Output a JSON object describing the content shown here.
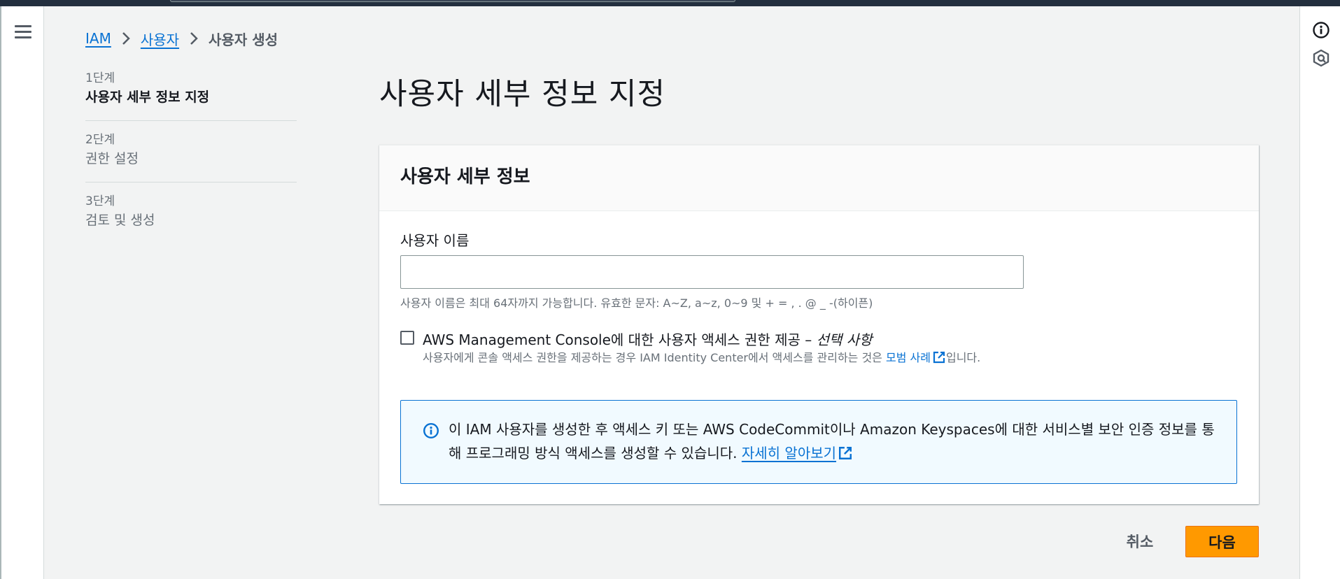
{
  "breadcrumb": {
    "items": [
      "IAM",
      "사용자"
    ],
    "current": "사용자 생성"
  },
  "steps": [
    {
      "number": "1단계",
      "title": "사용자 세부 정보 지정",
      "active": true
    },
    {
      "number": "2단계",
      "title": "권한 설정",
      "active": false
    },
    {
      "number": "3단계",
      "title": "검토 및 생성",
      "active": false
    }
  ],
  "page": {
    "title": "사용자 세부 정보 지정"
  },
  "container": {
    "title": "사용자 세부 정보",
    "username_label": "사용자 이름",
    "username_value": "",
    "username_help": "사용자 이름은 최대 64자까지 가능합니다. 유효한 문자: A~Z, a~z, 0~9 및 + = , . @ _ -(하이픈)",
    "console_access_label": "AWS Management Console에 대한 사용자 액세스 권한 제공 – ",
    "console_access_optional": "선택 사항",
    "console_access_checked": false,
    "console_access_desc_prefix": "사용자에게 콘솔 액세스 권한을 제공하는 경우 IAM Identity Center에서 액세스를 관리하는 것은 ",
    "console_access_desc_link": "모범 사례",
    "console_access_desc_suffix": "입니다."
  },
  "alert": {
    "text": "이 IAM 사용자를 생성한 후 액세스 키 또는 AWS CodeCommit이나 Amazon Keyspaces에 대한 서비스별 보안 인증 정보를 통해 프로그래밍 방식 액세스를 생성할 수 있습니다. ",
    "link": "자세히 알아보기"
  },
  "actions": {
    "cancel": "취소",
    "next": "다음"
  },
  "colors": {
    "primary": "#ff9900",
    "link": "#0972d3",
    "alert_bg": "#f1faff",
    "topbar": "#232f3e"
  },
  "icons": {
    "menu": "hamburger-menu-icon",
    "info": "info-circle-icon",
    "hexagon": "hexagon-settings-icon",
    "external": "external-link-icon",
    "chevron": "chevron-right-icon"
  }
}
